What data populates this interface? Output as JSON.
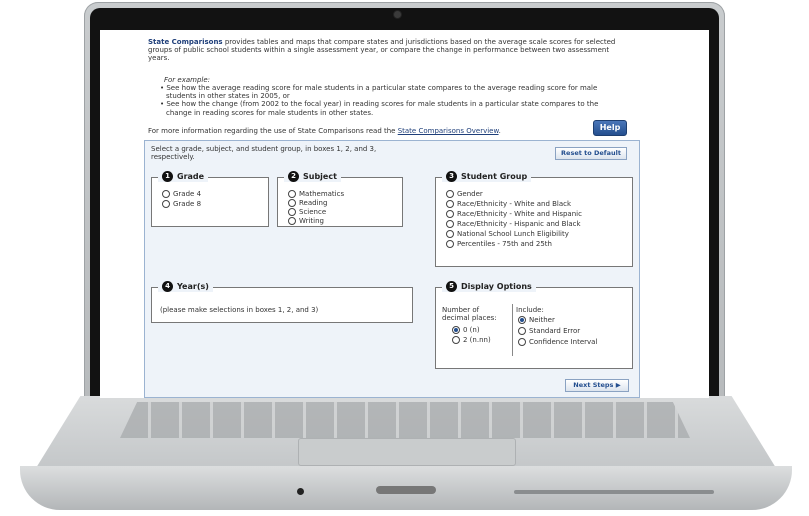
{
  "intro": {
    "brand": "State Comparisons",
    "text": " provides tables and maps that compare states and jurisdictions based on the average scale scores for selected groups of public school students within a single assessment year, or compare the change in performance between two assessment years.",
    "example_title": "For example:",
    "bullets": [
      "See how the average reading score for male students in a particular state compares to the average reading score for male students in other states in 2005, or",
      "See how the change (from 2002 to the focal year) in reading scores for male students in a particular state compares to the change in reading scores for male students in other states."
    ],
    "more_prefix": "For more information regarding the use of State Comparisons read the ",
    "more_link": "State Comparisons Overview",
    "more_suffix": "."
  },
  "help_label": "Help",
  "panel": {
    "instructions": "Select a grade, subject, and student group, in boxes 1, 2, and 3, respectively.",
    "reset_label": "Reset to Default",
    "next_label": "Next Steps ▶"
  },
  "grade": {
    "number": "1",
    "title": "Grade",
    "options": [
      "Grade 4",
      "Grade 8"
    ]
  },
  "subject": {
    "number": "2",
    "title": "Subject",
    "options": [
      "Mathematics",
      "Reading",
      "Science",
      "Writing"
    ]
  },
  "group": {
    "number": "3",
    "title": "Student Group",
    "options": [
      "Gender",
      "Race/Ethnicity - White and Black",
      "Race/Ethnicity - White and Hispanic",
      "Race/Ethnicity - Hispanic and Black",
      "National School Lunch Eligibility",
      "Percentiles - 75th and 25th"
    ]
  },
  "years": {
    "number": "4",
    "title": "Year(s)",
    "placeholder": "(please make selections in boxes 1, 2, and 3)"
  },
  "display": {
    "number": "5",
    "title": "Display Options",
    "decimal_label_1": "Number of",
    "decimal_label_2": "decimal places:",
    "decimal_options": [
      "0 (n)",
      "2 (n.nn)"
    ],
    "include_label": "Include:",
    "include_options": [
      "Neither",
      "Standard Error",
      "Confidence Interval"
    ]
  }
}
